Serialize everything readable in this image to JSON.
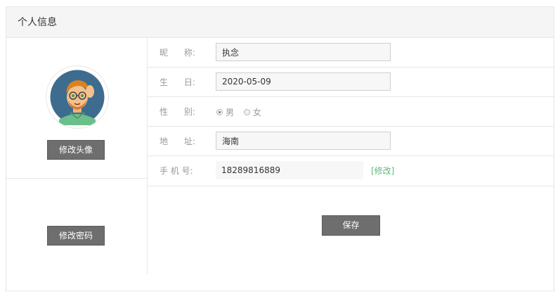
{
  "header": {
    "title": "个人信息"
  },
  "left": {
    "avatar_button": "修改头像",
    "password_button": "修改密码"
  },
  "form": {
    "nickname": {
      "label": "昵      称:",
      "value": "执念"
    },
    "birthday": {
      "label": "生      日:",
      "value": "2020-05-09"
    },
    "gender": {
      "label": "性      别:",
      "options": [
        {
          "label": "男",
          "checked": true
        },
        {
          "label": "女",
          "checked": false
        }
      ]
    },
    "address": {
      "label": "地      址:",
      "value": "海南"
    },
    "phone": {
      "label": "手 机 号:",
      "value": "18289816889",
      "modify_link": "[修改]"
    },
    "save_button": "保存"
  },
  "colors": {
    "button_bg": "#6e6e6e",
    "link_green": "#5fb878",
    "header_bg": "#f5f5f5"
  }
}
